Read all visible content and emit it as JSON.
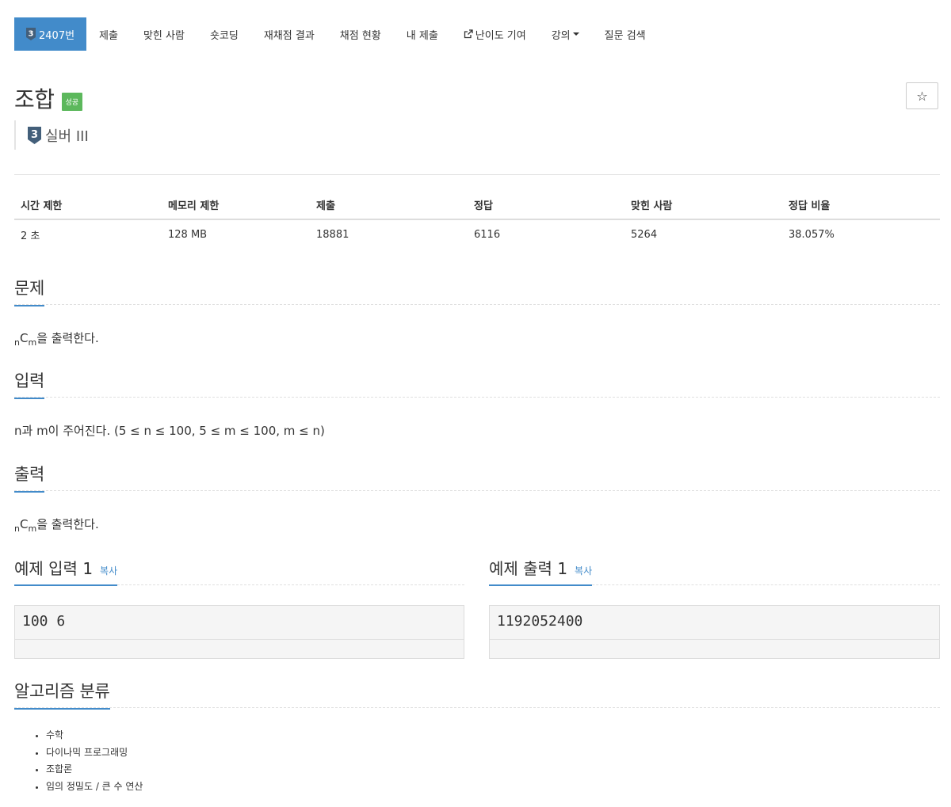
{
  "nav": {
    "tabs": [
      {
        "label": "2407번",
        "active": true
      },
      {
        "label": "제출"
      },
      {
        "label": "맞힌 사람"
      },
      {
        "label": "숏코딩"
      },
      {
        "label": "재채점 결과"
      },
      {
        "label": "채점 현황"
      },
      {
        "label": "내 제출"
      },
      {
        "label": "난이도 기여",
        "icon": "external-link-icon"
      },
      {
        "label": "강의",
        "dropdown": true
      },
      {
        "label": "질문 검색"
      }
    ]
  },
  "problem": {
    "title": "조합",
    "status_label": "성공",
    "star_icon": "star-outline-icon",
    "tier": {
      "number": "3",
      "label": "실버 III",
      "color": "#435f7a"
    }
  },
  "info_table": {
    "headers": [
      "시간 제한",
      "메모리 제한",
      "제출",
      "정답",
      "맞힌 사람",
      "정답 비율"
    ],
    "values": [
      "2 초",
      "128 MB",
      "18881",
      "6116",
      "5264",
      "38.057%"
    ]
  },
  "sections": {
    "description": {
      "title": "문제",
      "sub_n": "n",
      "letter": "C",
      "sub_m": "m",
      "text": "을 출력한다."
    },
    "input": {
      "title": "입력",
      "text": "n과 m이 주어진다. (5 ≤ n ≤ 100, 5 ≤ m ≤ 100, m ≤ n)"
    },
    "output": {
      "title": "출력",
      "sub_n": "n",
      "letter": "C",
      "sub_m": "m",
      "text": "을 출력한다."
    },
    "sample_input": {
      "title": "예제 입력 1",
      "copy_label": "복사",
      "value": "100 6"
    },
    "sample_output": {
      "title": "예제 출력 1",
      "copy_label": "복사",
      "value": "1192052400"
    },
    "algorithms": {
      "title": "알고리즘 분류",
      "items": [
        "수학",
        "다이나믹 프로그래밍",
        "조합론",
        "임의 정밀도 / 큰 수 연산"
      ]
    }
  },
  "colors": {
    "primary": "#428bca",
    "success": "#5cb85c",
    "tier_silver": "#435f7a"
  }
}
